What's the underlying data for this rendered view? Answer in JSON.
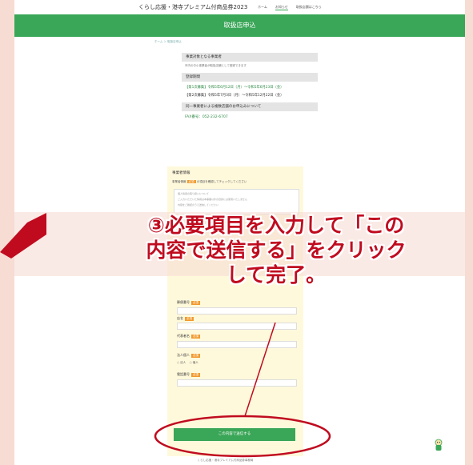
{
  "header": {
    "site_title": "くらし応援・港寺プレミアム付商品券2023",
    "nav": [
      "ホーム",
      "お知らせ",
      "取扱店舗はこちら"
    ]
  },
  "banner": {
    "title": "取扱店申込"
  },
  "breadcrumb": "ホーム ＞ 取扱店申込",
  "sections": [
    {
      "heading": "事業対象となる事業者",
      "text": "市内の中小事業者が取扱店舗として登録できます"
    },
    {
      "heading": "登録期間",
      "lines": [
        "【第1次募集】令和5年6月12日（月）〜令和5年6月23日（金）",
        "【第2次募集】令和5年7月3日（月）〜令和5年12月22日（金）"
      ]
    },
    {
      "heading": "同一事業者による複数店舗のお申込みについて",
      "fax": "FAX番号：052-232-6707"
    }
  ],
  "form": {
    "title": "事業者情報",
    "note_prefix": "事業者情報",
    "note_badge": "必須",
    "note_suffix": "の項目を確認してチェックしてください",
    "notice_lines": [
      "個人情報の取り扱いについて",
      "ご入力いただいた情報は本事業以外の目的には使用いたしません",
      "内容をご確認のうえ送信してください"
    ],
    "fields": [
      {
        "label": "郵便番号",
        "badge": "必須",
        "placeholder": ""
      },
      {
        "label": "店名",
        "badge": "必須",
        "placeholder": ""
      },
      {
        "label": "代表者名",
        "badge": "必須",
        "placeholder": ""
      },
      {
        "label": "電話番号",
        "badge": "必須",
        "placeholder": ""
      }
    ],
    "radio_label": "法人個人",
    "radio_badge": "必須",
    "radio_options": [
      "○ 法人",
      "○ 個人"
    ],
    "submit_label": "この内容で送信する"
  },
  "footer": "くらし応援・港寺プレミアム付商品券事務局",
  "callout": {
    "line1": "③必要項目を入力して「この",
    "line2": "内容で送信する」をクリック",
    "line3": "して完了。"
  },
  "colors": {
    "accent_green": "#3aa657",
    "callout_red": "#c00b1f",
    "required_orange": "#f29a2e",
    "backdrop": "#f6dcd3"
  }
}
